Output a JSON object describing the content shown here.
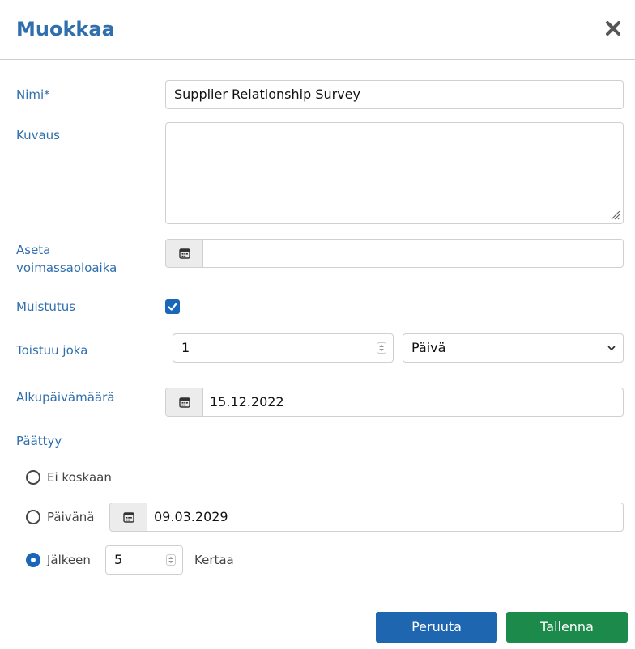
{
  "dialog": {
    "title": "Muokkaa",
    "close_icon": "close-icon"
  },
  "form": {
    "name": {
      "label": "Nimi*",
      "value": "Supplier Relationship Survey"
    },
    "description": {
      "label": "Kuvaus",
      "value": ""
    },
    "validity": {
      "label": "Aseta voimassaoloaika",
      "value": "",
      "icon": "calendar-icon"
    },
    "reminder": {
      "label": "Muistutus",
      "checked": true
    },
    "repeat": {
      "label": "Toistuu joka",
      "interval": "1",
      "unit": "Päivä"
    },
    "start_date": {
      "label": "Alkupäivämäärä",
      "value": "15.12.2022",
      "icon": "calendar-icon"
    },
    "ends": {
      "label": "Päättyy",
      "never": {
        "label": "Ei koskaan",
        "checked": false
      },
      "on_date": {
        "label": "Päivänä",
        "value": "09.03.2029",
        "checked": false
      },
      "after": {
        "label": "Jälkeen",
        "count": "5",
        "suffix": "Kertaa",
        "checked": true
      }
    }
  },
  "buttons": {
    "cancel": "Peruuta",
    "save": "Tallenna"
  },
  "colors": {
    "accent": "#2f6fae",
    "primary_button": "#1f66b1",
    "save_button": "#1b8a4a"
  }
}
